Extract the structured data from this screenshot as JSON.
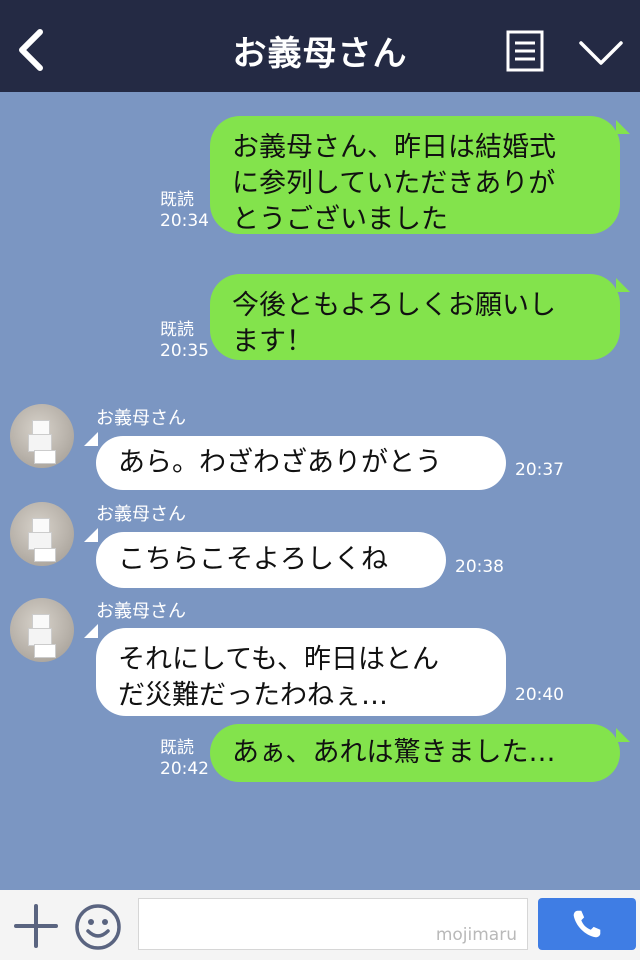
{
  "header": {
    "title": "お義母さん"
  },
  "messages_out": [
    {
      "text": "お義母さん、昨日は結婚式\nに参列していただきありが\nとうございました",
      "read": "既読",
      "time": "20:34"
    },
    {
      "text": "今後ともよろしくお願いし\nます！",
      "read": "既読",
      "time": "20:35"
    },
    {
      "text": "あぁ、あれは驚きました…",
      "read": "既読",
      "time": "20:42"
    }
  ],
  "messages_in": [
    {
      "sender": "お義母さん",
      "text": "あら。わざわざありがとう",
      "time": "20:37"
    },
    {
      "sender": "お義母さん",
      "text": "こちらこそよろしくね",
      "time": "20:38"
    },
    {
      "sender": "お義母さん",
      "text": "それにしても、昨日はとん\nだ災難だったわねぇ…",
      "time": "20:40"
    }
  ],
  "footer": {
    "watermark": "mojimaru"
  },
  "icons": [
    "back-icon",
    "menu-icon",
    "chevron-down-icon",
    "plus-icon",
    "smiley-icon",
    "phone-icon"
  ],
  "colors": {
    "header_bg": "#242a44",
    "chat_bg": "#7b96c2",
    "out_bubble": "#83e34c",
    "in_bubble": "#ffffff",
    "call_button": "#3f7de4"
  }
}
